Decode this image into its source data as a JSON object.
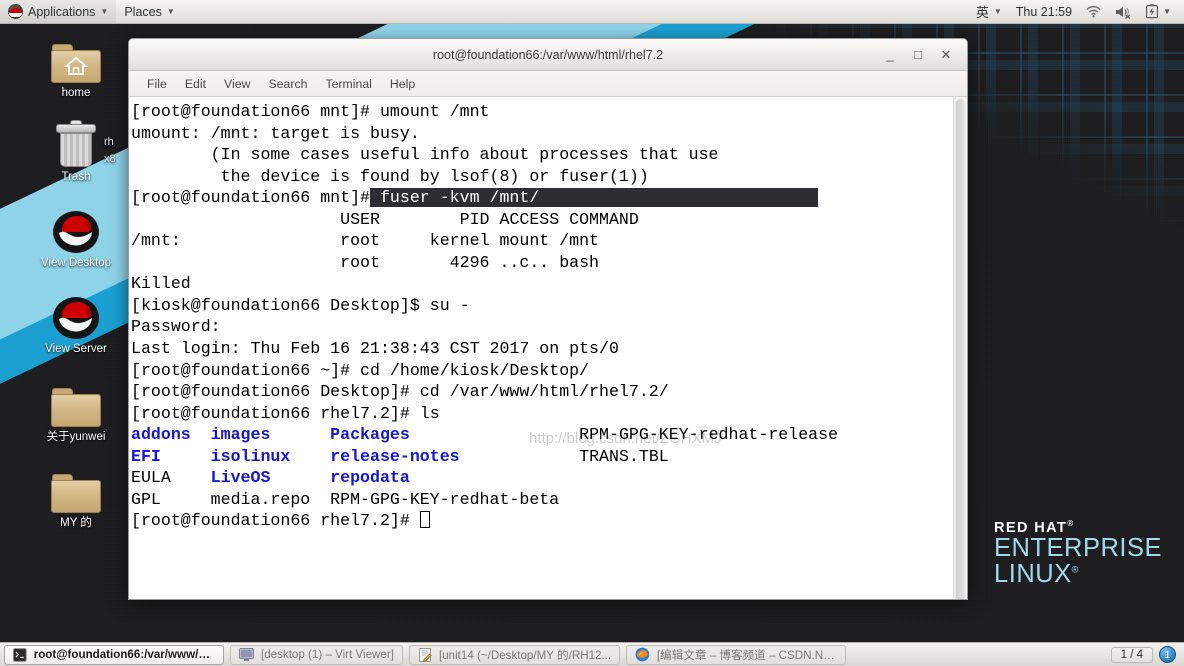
{
  "top_panel": {
    "applications_label": "Applications",
    "places_label": "Places",
    "ime_label": "英",
    "clock": "Thu 21:59",
    "icons": [
      "redhat-menu-icon",
      "wifi-icon",
      "volume-muted-icon",
      "battery-icon",
      "panel-chevron-icon"
    ]
  },
  "desktop": {
    "icons": [
      {
        "label": "home",
        "type": "home-folder"
      },
      {
        "label": "Trash",
        "type": "trash"
      },
      {
        "label": "View Desktop",
        "type": "redhat"
      },
      {
        "label": "View Server",
        "type": "redhat"
      },
      {
        "label": "关于yunwei",
        "type": "folder"
      },
      {
        "label": "MY 的",
        "type": "folder"
      }
    ],
    "occluded_label": "rh\nx8",
    "brand": {
      "red_hat": "RED HAT",
      "enterprise": "ENTERPRISE",
      "linux": "LINUX"
    },
    "colors": {
      "stripe_light": "#8ed3e8",
      "stripe_dark": "#1b9fd0",
      "background": "#1b1b1d",
      "brand_blue": "#9fd9ea"
    }
  },
  "terminal": {
    "title": "root@foundation66:/var/www/html/rhel7.2",
    "menu": [
      "File",
      "Edit",
      "View",
      "Search",
      "Terminal",
      "Help"
    ],
    "window_buttons": {
      "minimize": "_",
      "maximize": "□",
      "close": "✕"
    },
    "watermark": "http://blog.csdn.net/ZGHXMJ",
    "lines": [
      {
        "segments": [
          {
            "t": "[root@foundation66 mnt]# umount /mnt",
            "c": "plain"
          }
        ]
      },
      {
        "segments": [
          {
            "t": "umount: /mnt: target is busy.",
            "c": "plain"
          }
        ]
      },
      {
        "segments": [
          {
            "t": "        (In some cases useful info about processes that use",
            "c": "plain"
          }
        ]
      },
      {
        "segments": [
          {
            "t": "         the device is found by lsof(8) or fuser(1))",
            "c": "plain"
          }
        ]
      },
      {
        "segments": [
          {
            "t": "[root@foundation66 mnt]#",
            "c": "plain"
          },
          {
            "t": " fuser -kvm /mnt/                            ",
            "c": "inv"
          }
        ]
      },
      {
        "segments": [
          {
            "t": "                     USER        PID ACCESS COMMAND",
            "c": "plain"
          }
        ]
      },
      {
        "segments": [
          {
            "t": "/mnt:                root     kernel mount /mnt",
            "c": "plain"
          }
        ]
      },
      {
        "segments": [
          {
            "t": "                     root       4296 ..c.. bash",
            "c": "plain"
          }
        ]
      },
      {
        "segments": [
          {
            "t": "Killed",
            "c": "plain"
          }
        ]
      },
      {
        "segments": [
          {
            "t": "[kiosk@foundation66 Desktop]$ su -",
            "c": "plain"
          }
        ]
      },
      {
        "segments": [
          {
            "t": "Password:",
            "c": "plain"
          }
        ]
      },
      {
        "segments": [
          {
            "t": "Last login: Thu Feb 16 21:38:43 CST 2017 on pts/0",
            "c": "plain"
          }
        ]
      },
      {
        "segments": [
          {
            "t": "[root@foundation66 ~]# cd /home/kiosk/Desktop/",
            "c": "plain"
          }
        ]
      },
      {
        "segments": [
          {
            "t": "[root@foundation66 Desktop]# cd /var/www/html/rhel7.2/",
            "c": "plain"
          }
        ]
      },
      {
        "segments": [
          {
            "t": "[root@foundation66 rhel7.2]# ls",
            "c": "plain"
          }
        ]
      },
      {
        "segments": [
          {
            "t": "addons",
            "c": "blue"
          },
          {
            "t": "  ",
            "c": "plain"
          },
          {
            "t": "images",
            "c": "blue"
          },
          {
            "t": "      ",
            "c": "plain"
          },
          {
            "t": "Packages",
            "c": "blue"
          },
          {
            "t": "                 RPM-GPG-KEY-redhat-release",
            "c": "plain"
          }
        ]
      },
      {
        "segments": [
          {
            "t": "EFI",
            "c": "blue"
          },
          {
            "t": "     ",
            "c": "plain"
          },
          {
            "t": "isolinux",
            "c": "blue"
          },
          {
            "t": "    ",
            "c": "plain"
          },
          {
            "t": "release-notes",
            "c": "blue"
          },
          {
            "t": "            TRANS.TBL",
            "c": "plain"
          }
        ]
      },
      {
        "segments": [
          {
            "t": "EULA    ",
            "c": "plain"
          },
          {
            "t": "LiveOS",
            "c": "blue"
          },
          {
            "t": "      ",
            "c": "plain"
          },
          {
            "t": "repodata",
            "c": "blue"
          }
        ]
      },
      {
        "segments": [
          {
            "t": "GPL     media.repo  RPM-GPG-KEY-redhat-beta",
            "c": "plain"
          }
        ]
      },
      {
        "segments": [
          {
            "t": "[root@foundation66 rhel7.2]# ",
            "c": "plain"
          },
          {
            "t": "",
            "c": "cursor"
          }
        ]
      }
    ],
    "colors": {
      "dir_blue": "#1414e0",
      "highlight_bg": "#2b2f33",
      "text": "#000000"
    }
  },
  "taskbar": {
    "tasks": [
      {
        "label": "root@foundation66:/var/www/ht...",
        "icon": "terminal-icon",
        "active": true
      },
      {
        "label": "[desktop (1) – Virt Viewer]",
        "icon": "monitor-icon",
        "active": false
      },
      {
        "label": "[unit14 (~/Desktop/MY 的/RH12...",
        "icon": "gedit-icon",
        "active": false
      },
      {
        "label": "[编辑文章 – 博客频道 – CSDN.NE...",
        "icon": "firefox-icon",
        "active": false
      }
    ],
    "workspace_count": "1 / 4",
    "workspace_current": "1"
  }
}
